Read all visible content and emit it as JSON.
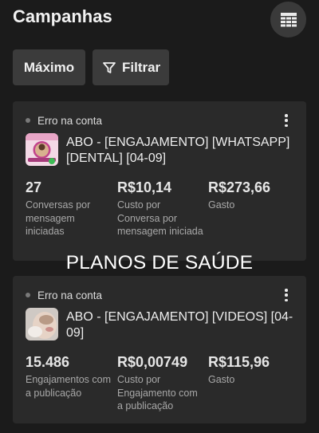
{
  "header": {
    "title": "Campanhas",
    "table_icon": "table-view-icon"
  },
  "filters": {
    "max_label": "Máximo",
    "filter_label": "Filtrar",
    "filter_icon": "funnel-icon"
  },
  "overlay_text": "PLANOS DE SAÚDE",
  "colors": {
    "background": "#1b1b1b",
    "card": "#2a2a2a",
    "chip": "#3b3b3b"
  },
  "campaigns": [
    {
      "status": "Erro na conta",
      "name": "ABO - [ENGAJAMENTO] [WHATSAPP] [DENTAL] [04-09]",
      "thumbnail_icon": "dental-ad-thumbnail",
      "metrics": [
        {
          "value": "27",
          "label": "Conversas por mensagem iniciadas"
        },
        {
          "value": "R$10,14",
          "label": "Custo por Conversa por mensagem iniciada"
        },
        {
          "value": "R$273,66",
          "label": "Gasto"
        }
      ]
    },
    {
      "status": "Erro na conta",
      "name": "ABO - [ENGAJAMENTO] [VIDEOS] [04-09]",
      "thumbnail_icon": "video-ad-thumbnail",
      "metrics": [
        {
          "value": "15.486",
          "label": "Engajamentos com a publicação"
        },
        {
          "value": "R$0,00749",
          "label": "Custo por Engajamento com a publicação"
        },
        {
          "value": "R$115,96",
          "label": "Gasto"
        }
      ]
    }
  ]
}
